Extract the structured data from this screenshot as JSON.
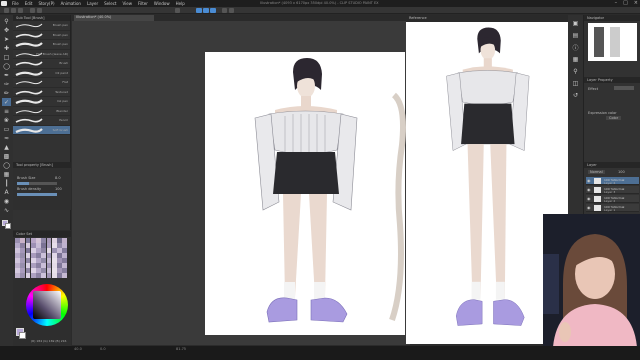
{
  "app": {
    "title": "Illustration* (4093 x 6170px 350dpi 40.0%) - CLIP STUDIO PAINT EX",
    "menu": [
      "File",
      "Edit",
      "Story(P)",
      "Animation",
      "Layer",
      "Select",
      "View",
      "Filter",
      "Window",
      "Help"
    ]
  },
  "subtool_panel": {
    "header": "Sub Tool [Brush]",
    "brushes": [
      {
        "name": "Brush pen"
      },
      {
        "name": "Brush pen"
      },
      {
        "name": "Brush pen"
      },
      {
        "name": "Flat Brush (leave AR)"
      },
      {
        "name": "Brush"
      },
      {
        "name": "Oil paint"
      },
      {
        "name": "Flat"
      },
      {
        "name": "Textured"
      },
      {
        "name": "Ink pen"
      },
      {
        "name": "Blender"
      },
      {
        "name": "Pencil"
      },
      {
        "name": "Soft brush"
      }
    ]
  },
  "tool_property": {
    "header": "Tool property [Brush]",
    "brush_size_label": "Brush Size",
    "brush_size_value": "8.0",
    "brush_density_label": "Brush density",
    "brush_density_value": "100",
    "brush_density_fraction": 1.0,
    "brush_size_fraction": 0.3
  },
  "color_set": {
    "header": "Color Set",
    "colors": [
      "#9a8fb0",
      "#c9b2c8",
      "#7f7a9c",
      "#b7a5c6",
      "#d3c3d6",
      "#8e86a6",
      "#a898b8",
      "#e0d3e2",
      "#6f6a8a",
      "#c0b0ca",
      "#b4a9c9",
      "#8a7fa0",
      "#d6cade",
      "#9d90b4",
      "#c8bdd6",
      "#7a7294",
      "#aca0c0",
      "#e6dde9",
      "#938aaa",
      "#bfb2cf",
      "#cfc4dc",
      "#a497b9",
      "#7d7597",
      "#d9cfe3",
      "#b0a4c4",
      "#8f86a5",
      "#e3d9e6",
      "#9c92b3",
      "#c6bad4",
      "#837b9c",
      "#b8acca",
      "#958cab",
      "#dbd1e4",
      "#a89bbc",
      "#877f9f",
      "#ccc1da",
      "#9f94b6",
      "#e1d8e8",
      "#7c7495",
      "#bdb1ce",
      "#d1c6dd",
      "#a699ba",
      "#8c84a3",
      "#dcd2e5",
      "#b2a6c6",
      "#918aa8",
      "#c4b9d3",
      "#e8e0eb",
      "#a093b5",
      "#837a9b",
      "#bcafcb",
      "#968eac",
      "#d8cee2",
      "#ab9fbf",
      "#8a81a1",
      "#cabfd9",
      "#9d92b4",
      "#e4dbe8",
      "#7f7798",
      "#c2b6d1",
      "#d4c9df",
      "#a99cbd",
      "#8e85a4",
      "#ded4e6",
      "#b5a9c8",
      "#938ba9",
      "#c7bcd5",
      "#eae2ec",
      "#a396b7",
      "#867e9e",
      "#bfb3cd",
      "#998fae",
      "#dad0e3",
      "#ada1c1",
      "#8c83a2",
      "#cdc2db",
      "#a094b5",
      "#e6dde9",
      "#827a9a",
      "#c5b9d2"
    ]
  },
  "color_wheel": {
    "main_color": "#b8a9d8",
    "sub_color": "#ffffff",
    "code": "(R) 184 (G) 169 (B) 216"
  },
  "canvas": {
    "tab_label": "Illustration* (40.0%)",
    "zoom": "40.0",
    "angle": "0.0",
    "coords": "81.75"
  },
  "reference": {
    "tab_label": "Reference"
  },
  "navigator": {
    "header": "Navigator"
  },
  "layer_property": {
    "header": "Layer Property",
    "effect_label": "Effect",
    "expression_label": "Expression color",
    "expression_value": "Color"
  },
  "layers": {
    "header": "Layer",
    "blend_mode": "Normal",
    "opacity": "100",
    "items": [
      {
        "opacity": "100 %Normal",
        "name": "Layer 4"
      },
      {
        "opacity": "100 %Normal",
        "name": "Layer 3"
      },
      {
        "opacity": "100 %Normal",
        "name": "Layer 2"
      },
      {
        "opacity": "100 %Normal",
        "name": "Layer 1"
      }
    ]
  },
  "colors": {
    "accent": "#4a8cd4",
    "panel": "#323232",
    "selection": "#4d6f94"
  }
}
